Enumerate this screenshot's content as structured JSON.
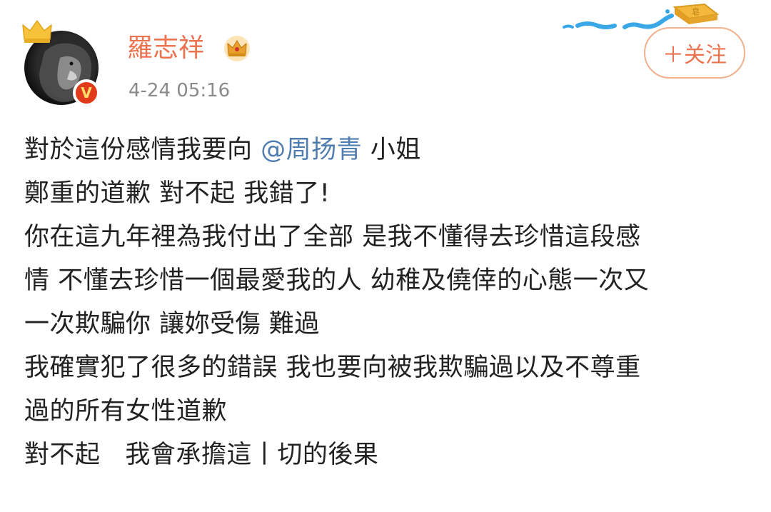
{
  "post": {
    "author": {
      "name": "羅志祥",
      "avatar_icon": "lion-avatar",
      "verified_badge_text": "V",
      "crown_icon": "crown-icon",
      "vip_icon": "vip-crown-icon"
    },
    "timestamp": "4-24 05:16",
    "follow_button": {
      "label": "＋关注"
    },
    "content": {
      "line1_pre": "對於這份感情我要向 ",
      "mention": "@周扬青",
      "line1_post": " 小姐",
      "line2": "鄭重的道歉 對不起 我錯了!",
      "line3": "你在這九年裡為我付出了全部 是我不懂得去珍惜這段感",
      "line4": "情 不懂去珍惜一個最愛我的人 幼稚及僥倖的心態一次又",
      "line5": "一次欺騙你 讓妳受傷 難過",
      "line6": "我確實犯了很多的錯誤 我也要向被我欺騙過以及不尊重",
      "line7": "過的所有女性道歉",
      "line8": "對不起   我會承擔這丨切的後果"
    }
  },
  "colors": {
    "username": "#eb7350",
    "mention": "#507daf",
    "text": "#222222",
    "timestamp": "#8a8a8a",
    "follow_border": "#f1b08c"
  }
}
